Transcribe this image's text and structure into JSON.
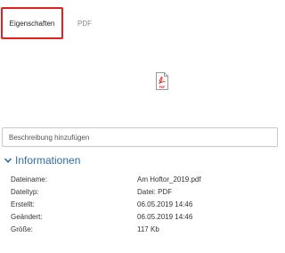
{
  "tabs": [
    {
      "label": "Eigenschaften",
      "active": true
    },
    {
      "label": "PDF",
      "active": false
    }
  ],
  "file_icon": {
    "icon": "pdf-file-icon",
    "label": "PDF",
    "color": "#d9231e"
  },
  "description": {
    "placeholder": "Beschreibung hinzufügen",
    "value": ""
  },
  "info_section": {
    "title": "Informationen",
    "expanded": true,
    "rows": [
      {
        "label": "Dateiname:",
        "value": "Am Hoftor_2019.pdf"
      },
      {
        "label": "Dateityp:",
        "value": "Datei: PDF"
      },
      {
        "label": "Erstellt:",
        "value": "06.05.2019 14:46"
      },
      {
        "label": "Geändert:",
        "value": "06.05.2019 14:46"
      },
      {
        "label": "Größe:",
        "value": "117 Kb"
      }
    ]
  },
  "colors": {
    "accent": "#2f6ea3",
    "active_tab_border": "#e02020"
  }
}
